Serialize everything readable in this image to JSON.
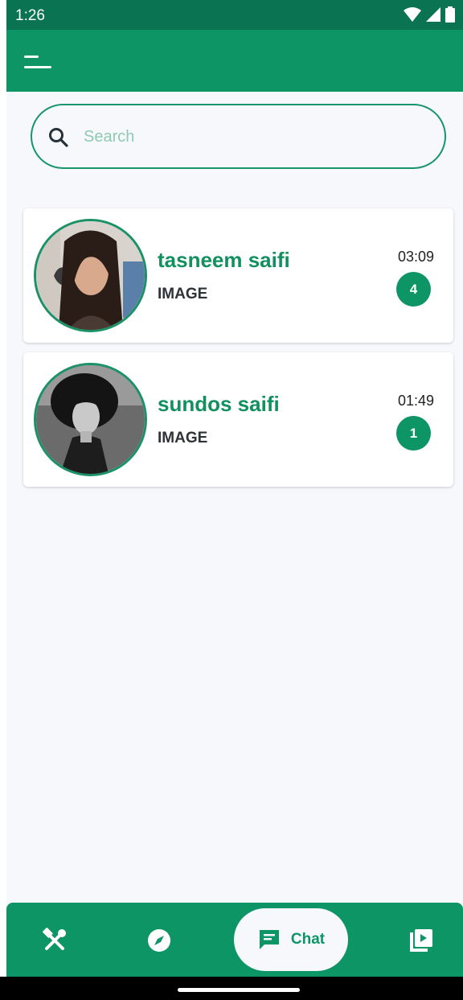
{
  "status_bar": {
    "time": "1:26",
    "icons": [
      "wifi-icon",
      "signal-icon",
      "battery-icon"
    ]
  },
  "app_bar": {
    "menu_icon": "menu-icon",
    "color": "#0e9566"
  },
  "search": {
    "placeholder": "Search",
    "value": "",
    "icon": "search-icon"
  },
  "chats": [
    {
      "name": "tasneem saifi",
      "preview": "IMAGE",
      "time": "03:09",
      "unread": "4"
    },
    {
      "name": "sundos saifi",
      "preview": "IMAGE",
      "time": "01:49",
      "unread": "1"
    }
  ],
  "bottom_nav": {
    "items": [
      {
        "icon": "tools-icon",
        "label": ""
      },
      {
        "icon": "explore-compass-icon",
        "label": ""
      },
      {
        "icon": "chat-icon",
        "label": "Chat",
        "selected": true
      },
      {
        "icon": "video-library-icon",
        "label": ""
      }
    ]
  },
  "colors": {
    "primary": "#0e9566",
    "status_bar": "#0a7352",
    "background": "#f7f8fc",
    "name_text": "#12905f"
  }
}
